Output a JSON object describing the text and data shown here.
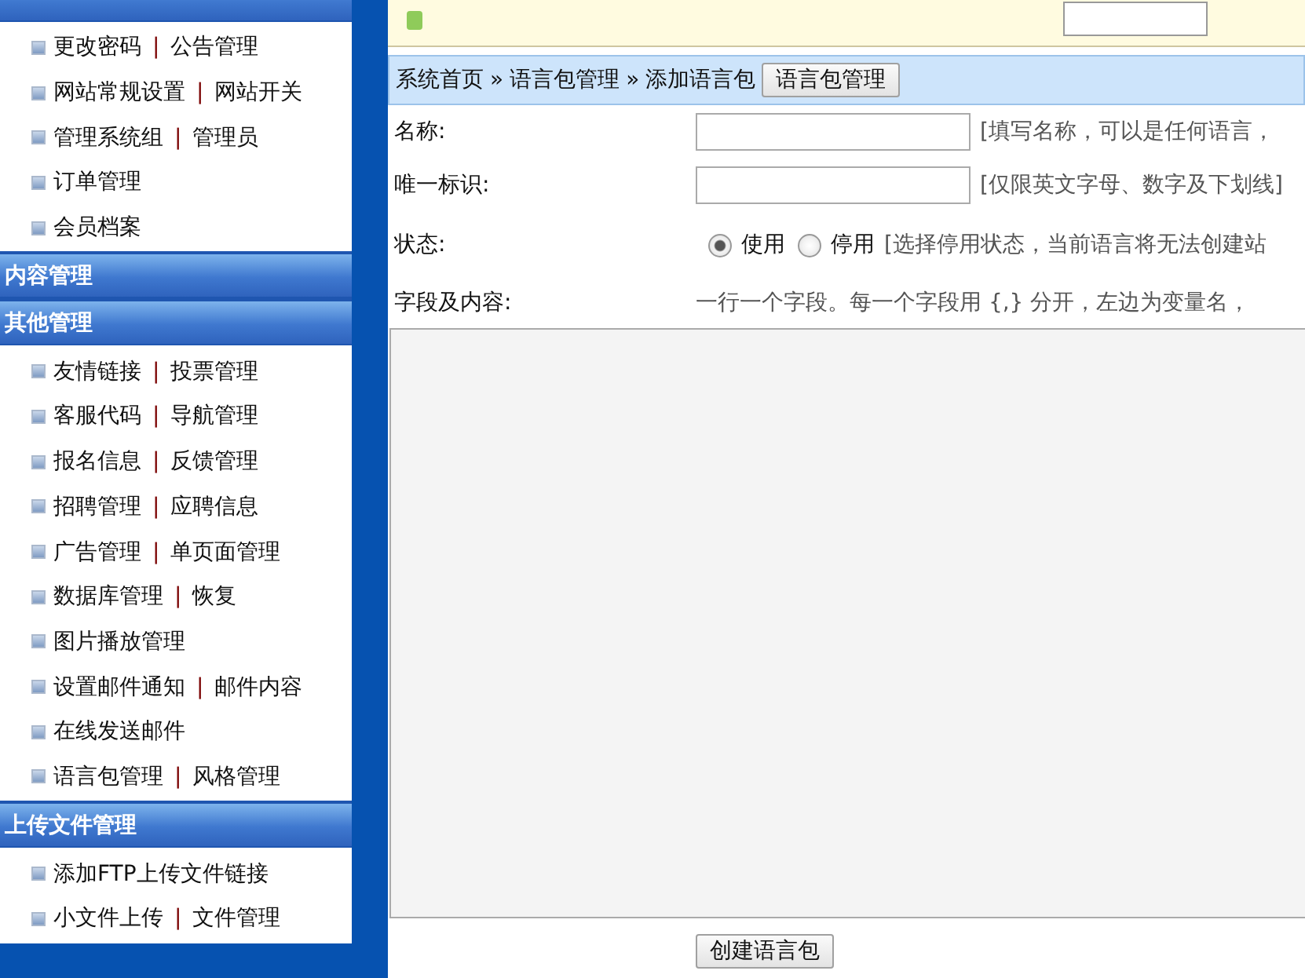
{
  "sidebar": {
    "sections": [
      {
        "items": [
          {
            "links": [
              "更改密码",
              "公告管理"
            ],
            "separator": "|"
          },
          {
            "links": [
              "网站常规设置",
              "网站开关"
            ],
            "separator": "|"
          },
          {
            "links": [
              "管理系统组",
              "管理员"
            ],
            "separator": "|"
          },
          {
            "links": [
              "订单管理"
            ]
          },
          {
            "links": [
              "会员档案"
            ]
          }
        ]
      },
      {
        "title": "内容管理"
      },
      {
        "title": "其他管理",
        "items": [
          {
            "links": [
              "友情链接",
              "投票管理"
            ],
            "separator": "|"
          },
          {
            "links": [
              "客服代码",
              "导航管理"
            ],
            "separator": "|"
          },
          {
            "links": [
              "报名信息",
              "反馈管理"
            ],
            "separator": "|"
          },
          {
            "links": [
              "招聘管理",
              "应聘信息"
            ],
            "separator": "|"
          },
          {
            "links": [
              "广告管理",
              "单页面管理"
            ],
            "separator": "|"
          },
          {
            "links": [
              "数据库管理",
              "恢复"
            ],
            "separator": "|"
          },
          {
            "links": [
              "图片播放管理"
            ]
          },
          {
            "links": [
              "设置邮件通知",
              "邮件内容"
            ],
            "separator": "|"
          },
          {
            "links": [
              "在线发送邮件"
            ]
          },
          {
            "links": [
              "语言包管理",
              "风格管理"
            ],
            "separator": "|"
          }
        ]
      },
      {
        "title": "上传文件管理",
        "items": [
          {
            "links": [
              "添加FTP上传文件链接"
            ]
          },
          {
            "links": [
              "小文件上传",
              "文件管理"
            ],
            "separator": "|"
          }
        ]
      }
    ]
  },
  "breadcrumb": {
    "items": [
      "系统首页",
      "语言包管理",
      "添加语言包"
    ],
    "separator": "»",
    "button": "语言包管理"
  },
  "form": {
    "fields": [
      {
        "kind": "input",
        "label": "名称:",
        "hint": "[填写名称，可以是任何语言，"
      },
      {
        "kind": "input",
        "label": "唯一标识:",
        "hint": "[仅限英文字母、数字及下划线]"
      },
      {
        "kind": "radio",
        "label": "状态:",
        "options": [
          {
            "label": "使用",
            "selected": true
          },
          {
            "label": "停用",
            "selected": false
          }
        ],
        "hint": "[选择停用状态，当前语言将无法创建站"
      },
      {
        "kind": "textarea",
        "label": "字段及内容:",
        "hint": "一行一个字段。每一个字段用 {,} 分开，左边为变量名，"
      }
    ],
    "submit": "创建语言包"
  }
}
